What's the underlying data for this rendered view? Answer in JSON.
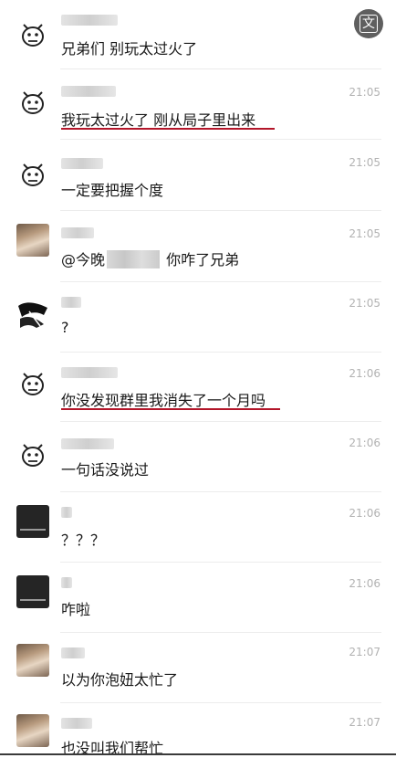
{
  "translate_icon": "translate-icon",
  "messages": [
    {
      "avatar": "doodle-face",
      "time": "",
      "text": "兄弟们 别玩太过火了",
      "underline": false,
      "mention": ""
    },
    {
      "avatar": "doodle-face",
      "time": "21:05",
      "text": "我玩太过火了 刚从局子里出来",
      "underline": true,
      "mention": ""
    },
    {
      "avatar": "doodle-face",
      "time": "21:05",
      "text": "一定要把握个度",
      "underline": false,
      "mention": ""
    },
    {
      "avatar": "photo",
      "time": "21:05",
      "text_prefix": "@今晚",
      "text_suffix": "你咋了兄弟",
      "underline": false
    },
    {
      "avatar": "ink",
      "time": "21:05",
      "text": "?",
      "underline": false,
      "mention": ""
    },
    {
      "avatar": "doodle-face",
      "time": "21:06",
      "text": "你没发现群里我消失了一个月吗",
      "underline": true,
      "mention": ""
    },
    {
      "avatar": "doodle-face",
      "time": "21:06",
      "text": "一句话没说过",
      "underline": false,
      "mention": ""
    },
    {
      "avatar": "dark",
      "time": "21:06",
      "text": "？？？",
      "underline": false,
      "mention": ""
    },
    {
      "avatar": "dark",
      "time": "21:06",
      "text": "咋啦",
      "underline": false,
      "mention": ""
    },
    {
      "avatar": "photo",
      "time": "21:07",
      "text": "以为你泡妞太忙了",
      "underline": false,
      "mention": ""
    },
    {
      "avatar": "photo",
      "time": "21:07",
      "text": "也没叫我们帮忙",
      "underline": false,
      "mention": ""
    }
  ]
}
